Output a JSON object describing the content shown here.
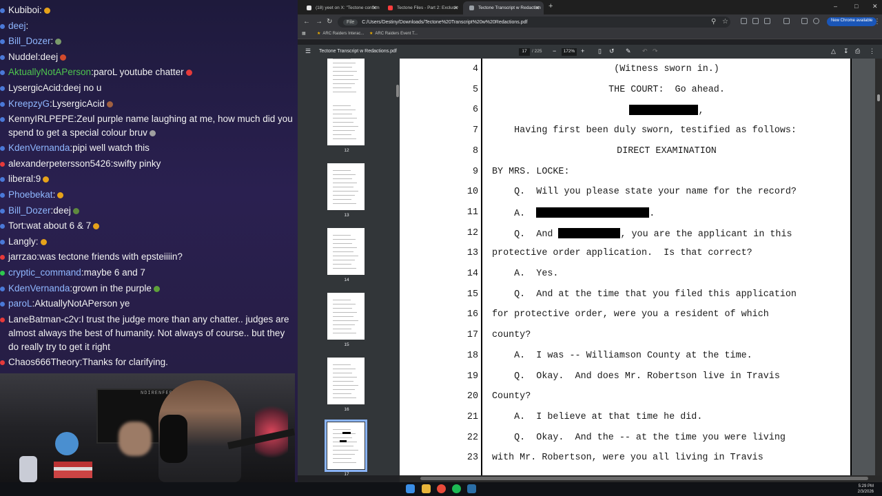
{
  "chat": {
    "messages": [
      {
        "user": "Kubiboi",
        "text": "",
        "user_color": "#f0f0f0",
        "dot": "#4a79d8",
        "emote": "#e6a21a"
      },
      {
        "user": "deej",
        "text": "",
        "user_color": "#8fb7ff",
        "dot": "#4a79d8",
        "emote": ""
      },
      {
        "user": "Bill_Dozer",
        "text": "",
        "user_color": "#8fb7ff",
        "dot": "#4a79d8",
        "emote": "#7a9a6a"
      },
      {
        "user": "Nuddel",
        "text": "deej",
        "user_color": "#f0f0f0",
        "dot": "#4a79d8",
        "emote": "#d24a2c"
      },
      {
        "user": "AktuallyNotAPerson",
        "text": "paroL  youtube chatter",
        "user_color": "#4ec44e",
        "dot": "#4a79d8",
        "emote": "#e63a3a"
      },
      {
        "user": "LysergicAcid",
        "text": "deej no u",
        "user_color": "#f0f0f0",
        "dot": "#4a79d8",
        "emote": ""
      },
      {
        "user": "KreepzyG",
        "text": "LysergicAcid",
        "user_color": "#8fb7ff",
        "dot": "#4a79d8",
        "emote": "#a06040"
      },
      {
        "user": "KennyIRLPEPE",
        "text": "Zeul purple name laughing at me, how much did you spend to get a special colour bruv",
        "user_color": "#f0f0f0",
        "dot": "#4a79d8",
        "emote": "#a0a0a0"
      },
      {
        "user": "KdenVernanda",
        "text": "pipi well watch this",
        "user_color": "#8fb7ff",
        "dot": "#4a79d8",
        "emote": ""
      },
      {
        "user": "alexanderpetersson5426",
        "text": "swifty pinky",
        "user_color": "#f0f0f0",
        "dot": "#e63a3a",
        "emote": ""
      },
      {
        "user": "liberal",
        "text": "9",
        "user_color": "#f0f0f0",
        "dot": "#4a79d8",
        "emote": "#e6a21a"
      },
      {
        "user": "Phoebekat",
        "text": "",
        "user_color": "#8fb7ff",
        "dot": "#4a79d8",
        "emote": "#e6a21a"
      },
      {
        "user": "Bill_Dozer",
        "text": "deej",
        "user_color": "#8fb7ff",
        "dot": "#4a79d8",
        "emote": "#5e8a3e"
      },
      {
        "user": "Tort",
        "text": "wat about 6 & 7",
        "user_color": "#f0f0f0",
        "dot": "#4a79d8",
        "emote": "#e6a21a"
      },
      {
        "user": "Langly",
        "text": "",
        "user_color": "#f0f0f0",
        "dot": "#4a79d8",
        "emote": "#e6a21a"
      },
      {
        "user": "jarrzao",
        "text": "was tectone friends with epsteiiiin?",
        "user_color": "#f0f0f0",
        "dot": "#e63a3a",
        "emote": ""
      },
      {
        "user": "cryptic_command",
        "text": "maybe 6 and 7",
        "user_color": "#8fb7ff",
        "dot": "#2ec84e",
        "emote": ""
      },
      {
        "user": "KdenVernanda",
        "text": "grown in the purple",
        "user_color": "#8fb7ff",
        "dot": "#4a79d8",
        "emote": "#5ea03a"
      },
      {
        "user": "paroL",
        "text": "AktuallyNotAPerson ye",
        "user_color": "#8fb7ff",
        "dot": "#4a79d8",
        "emote": ""
      },
      {
        "user": "LaneBatman-c2v",
        "text": "I trust the judge more than any chatter.. judges are almost always the best of humanity. Not always of course.. but they do really try to get it right",
        "user_color": "#f0f0f0",
        "dot": "#e63a3a",
        "emote": ""
      },
      {
        "user": "Chaos666Theory",
        "text": "Thanks for clarifying.",
        "user_color": "#f0f0f0",
        "dot": "#e63a3a",
        "emote": ""
      }
    ]
  },
  "webcam": {
    "label": "NDIRENFER SUBS"
  },
  "browser": {
    "tabs": [
      {
        "label": "(18) yeet on X: \"Tectone confirm",
        "active": false,
        "fav_color": "#e8e8e8"
      },
      {
        "label": "Tectone Files - Part 2: Exclusiv",
        "active": false,
        "fav_color": "#ff3d3d"
      },
      {
        "label": "Tectone Transcript w Redaction",
        "active": true,
        "fav_color": "#9aa0a6"
      }
    ],
    "url_chip": "File",
    "url": "C:/Users/Destiny/Downloads/Tectone%20Transcript%20w%20Redactions.pdf",
    "update_label": "New Chrome available",
    "bookmarks": [
      {
        "label": "ARC Raiders Interac..."
      },
      {
        "label": "ARC Raiders Event T..."
      }
    ]
  },
  "pdf": {
    "title": "Tectone Transcript w Redactions.pdf",
    "page_current": "17",
    "page_total": "/ 225",
    "zoom": "172%",
    "thumbnails": [
      "11",
      "12",
      "13",
      "14",
      "15",
      "16",
      "17"
    ],
    "selected_thumbnail": "17",
    "lines": [
      {
        "n": "4",
        "text": "(Witness sworn in.)",
        "align": "center"
      },
      {
        "n": "5",
        "text": "THE COURT:  Go ahead.",
        "align": "center"
      },
      {
        "n": "6",
        "text": ",",
        "align": "redacted-center"
      },
      {
        "n": "7",
        "text": "    Having first been duly sworn, testified as follows:",
        "align": "left"
      },
      {
        "n": "8",
        "text": "DIRECT EXAMINATION",
        "align": "center"
      },
      {
        "n": "9",
        "text": "BY MRS. LOCKE:",
        "align": "left"
      },
      {
        "n": "10",
        "text": "    Q.  Will you please state your name for the record?",
        "align": "left"
      },
      {
        "n": "11",
        "text": ".",
        "align": "redacted-a"
      },
      {
        "n": "12",
        "text": ", you are the applicant in this",
        "align": "redacted-q"
      },
      {
        "n": "13",
        "text": "protective order application.  Is that correct?",
        "align": "left"
      },
      {
        "n": "14",
        "text": "    A.  Yes.",
        "align": "left"
      },
      {
        "n": "15",
        "text": "    Q.  And at the time that you filed this application",
        "align": "left"
      },
      {
        "n": "16",
        "text": "for protective order, were you a resident of which",
        "align": "left"
      },
      {
        "n": "17",
        "text": "county?",
        "align": "left"
      },
      {
        "n": "18",
        "text": "    A.  I was -- Williamson County at the time.",
        "align": "left"
      },
      {
        "n": "19",
        "text": "    Q.  Okay.  And does Mr. Robertson live in Travis",
        "align": "left"
      },
      {
        "n": "20",
        "text": "County?",
        "align": "left"
      },
      {
        "n": "21",
        "text": "    A.  I believe at that time he did.",
        "align": "left"
      },
      {
        "n": "22",
        "text": "    Q.  Okay.  And the -- at the time you were living",
        "align": "left"
      },
      {
        "n": "23",
        "text": "with Mr. Robertson, were you all living in Travis",
        "align": "left"
      }
    ],
    "a_prefix": "    A.  ",
    "q_prefix": "    Q.  And "
  },
  "taskbar": {
    "time": "5:29 PM",
    "date": "2/3/2026"
  }
}
